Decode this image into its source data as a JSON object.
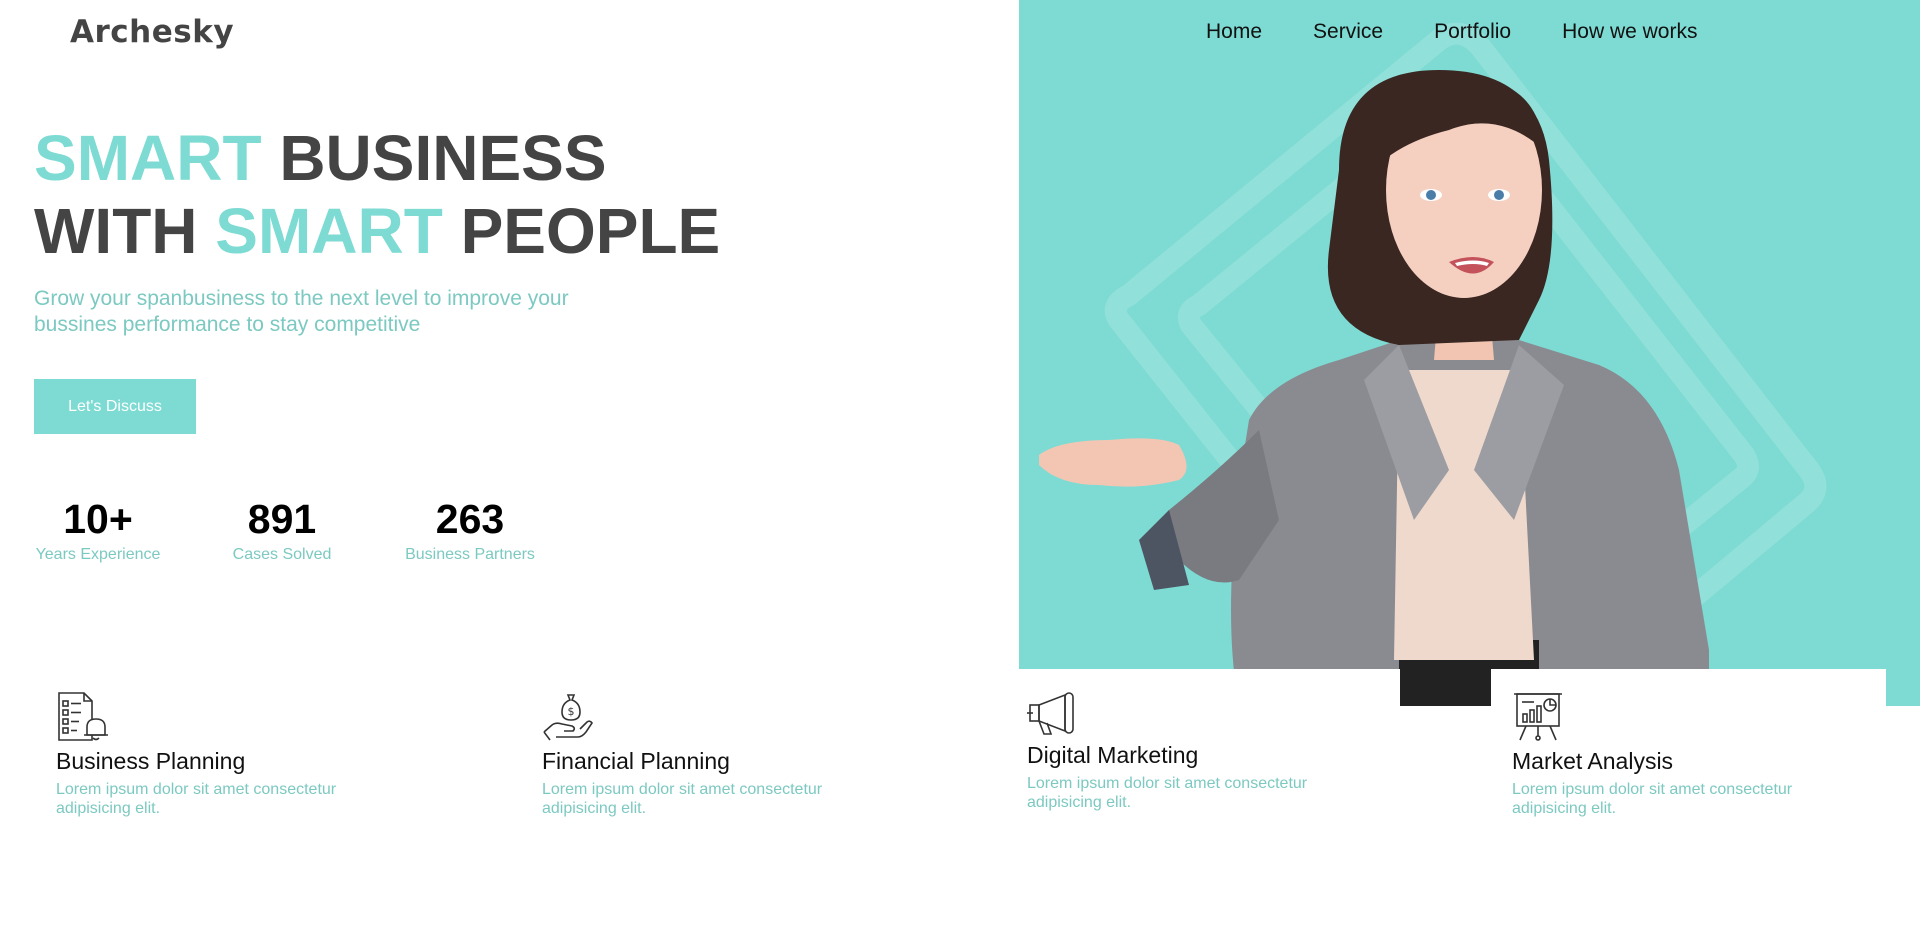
{
  "brand": "Archesky",
  "nav": [
    "Home",
    "Service",
    "Portfolio",
    "How we works"
  ],
  "hero": {
    "line1_accent": "SMART",
    "line1_rest": " BUSINESS",
    "line2_start": "WITH ",
    "line2_accent": "SMART",
    "line2_end": " PEOPLE",
    "subtitle": "Grow your spanbusiness to the next level to improve your bussines performance to stay competitive",
    "cta_label": "Let's Discuss"
  },
  "stats": [
    {
      "value": "10+",
      "label": "Years Experience"
    },
    {
      "value": "891",
      "label": "Cases Solved"
    },
    {
      "value": "263",
      "label": "Business Partners"
    }
  ],
  "services": [
    {
      "icon": "checklist-bell-icon",
      "title": "Business Planning",
      "desc": "Lorem ipsum dolor sit amet consectetur adipisicing elit."
    },
    {
      "icon": "money-bag-hand-icon",
      "title": "Financial Planning",
      "desc": "Lorem ipsum dolor sit amet consectetur adipisicing elit."
    },
    {
      "icon": "megaphone-icon",
      "title": "Digital Marketing",
      "desc": "Lorem ipsum dolor sit amet consectetur adipisicing elit."
    },
    {
      "icon": "presentation-board-icon",
      "title": "Market Analysis",
      "desc": "Lorem ipsum dolor sit amet consectetur adipisicing elit."
    }
  ],
  "colors": {
    "accent": "#7ddbd3",
    "heading": "#444444",
    "muted_text": "#7cc9c1"
  }
}
